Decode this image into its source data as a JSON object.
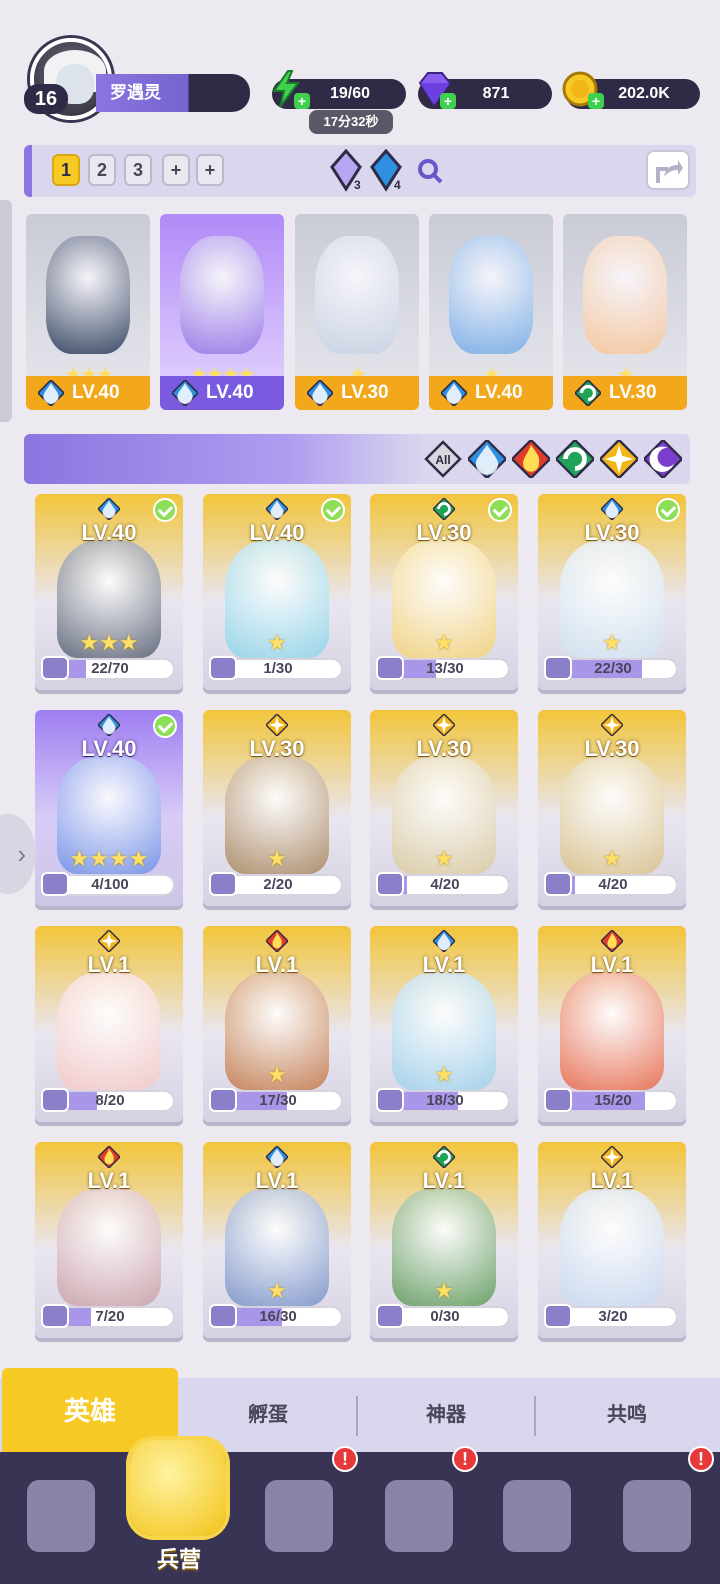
{
  "player": {
    "level": "16",
    "name": "罗遇灵"
  },
  "resources": {
    "energy": "19/60",
    "energy_timer": "17分32秒",
    "gems": "871",
    "gold": "202.0K"
  },
  "team_bar": {
    "tabs": [
      "1",
      "2",
      "3",
      "+",
      "+"
    ],
    "active_tab": "1",
    "counter_a": "3",
    "counter_b": "4"
  },
  "team_heroes": [
    {
      "level": "LV.40",
      "stars": "★★★",
      "element": "water",
      "color": "gray"
    },
    {
      "level": "LV.40",
      "stars": "★★★★",
      "element": "water",
      "color": "purple"
    },
    {
      "level": "LV.30",
      "stars": "★",
      "element": "water",
      "color": "gray"
    },
    {
      "level": "LV.40",
      "stars": "★",
      "element": "water",
      "color": "gray"
    },
    {
      "level": "LV.30",
      "stars": "★",
      "element": "wind",
      "color": "gray"
    }
  ],
  "filters": [
    "All",
    "water",
    "fire",
    "wind",
    "light",
    "dark"
  ],
  "filter_all_label": "All",
  "heroes": [
    {
      "level": "LV.40",
      "progress": "22/70",
      "fill": 0.314,
      "stars": "★★★",
      "element": "water",
      "checked": true,
      "rarity": "gold"
    },
    {
      "level": "LV.40",
      "progress": "1/30",
      "fill": 0.033,
      "stars": "★",
      "element": "water",
      "checked": true,
      "rarity": "gold"
    },
    {
      "level": "LV.30",
      "progress": "13/30",
      "fill": 0.433,
      "stars": "★",
      "element": "wind",
      "checked": true,
      "rarity": "gold"
    },
    {
      "level": "LV.30",
      "progress": "22/30",
      "fill": 0.733,
      "stars": "★",
      "element": "water",
      "checked": true,
      "rarity": "gold"
    },
    {
      "level": "LV.40",
      "progress": "4/100",
      "fill": 0.04,
      "stars": "★★★★",
      "element": "water",
      "checked": true,
      "rarity": "purple"
    },
    {
      "level": "LV.30",
      "progress": "2/20",
      "fill": 0.1,
      "stars": "★",
      "element": "light",
      "checked": false,
      "rarity": "gold"
    },
    {
      "level": "LV.30",
      "progress": "4/20",
      "fill": 0.2,
      "stars": "★",
      "element": "light",
      "checked": false,
      "rarity": "gold"
    },
    {
      "level": "LV.30",
      "progress": "4/20",
      "fill": 0.2,
      "stars": "★",
      "element": "light",
      "checked": false,
      "rarity": "gold"
    },
    {
      "level": "LV.1",
      "progress": "8/20",
      "fill": 0.4,
      "stars": "",
      "element": "light",
      "checked": false,
      "rarity": "gold"
    },
    {
      "level": "LV.1",
      "progress": "17/30",
      "fill": 0.567,
      "stars": "★",
      "element": "fire",
      "checked": false,
      "rarity": "gold"
    },
    {
      "level": "LV.1",
      "progress": "18/30",
      "fill": 0.6,
      "stars": "★",
      "element": "water",
      "checked": false,
      "rarity": "gold"
    },
    {
      "level": "LV.1",
      "progress": "15/20",
      "fill": 0.75,
      "stars": "",
      "element": "fire",
      "checked": false,
      "rarity": "gold"
    },
    {
      "level": "LV.1",
      "progress": "7/20",
      "fill": 0.35,
      "stars": "",
      "element": "fire",
      "checked": false,
      "rarity": "gold"
    },
    {
      "level": "LV.1",
      "progress": "16/30",
      "fill": 0.533,
      "stars": "★",
      "element": "water",
      "checked": false,
      "rarity": "gold"
    },
    {
      "level": "LV.1",
      "progress": "0/30",
      "fill": 0.0,
      "stars": "★",
      "element": "wind",
      "checked": false,
      "rarity": "gold"
    },
    {
      "level": "LV.1",
      "progress": "3/20",
      "fill": 0.15,
      "stars": "",
      "element": "light",
      "checked": false,
      "rarity": "gold"
    }
  ],
  "subtabs": [
    "英雄",
    "孵蛋",
    "神器",
    "共鸣"
  ],
  "active_subtab": "英雄",
  "nav": {
    "active_label": "兵营",
    "alerts": [
      "!",
      "!",
      "!"
    ]
  },
  "colors": {
    "water": "#2f8fe0",
    "fire": "#e23b2a",
    "wind": "#21a45a",
    "light": "#f2b619",
    "dark": "#7b3fd0",
    "accent_gold": "#f7c925",
    "accent_purple": "#8b75e0",
    "nav_bg": "#3a3454"
  }
}
